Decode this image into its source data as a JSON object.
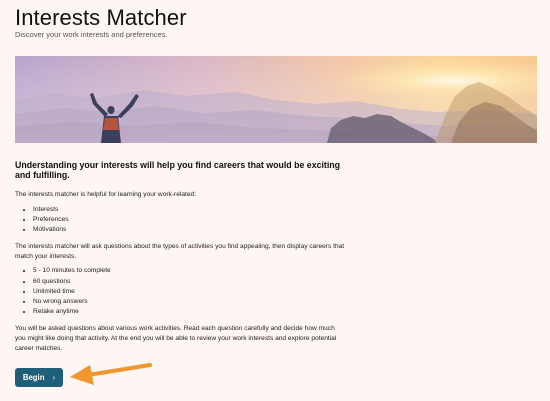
{
  "header": {
    "title": "Interests Matcher",
    "subtitle": "Discover your work interests and preferences."
  },
  "hero": {
    "image_alt": "Person with raised arms overlooking mountains at sunset"
  },
  "content": {
    "lead": "Understanding your interests will help you find careers that would be exciting and fulfilling.",
    "intro": "The interests matcher is helpful for learning your work-related:",
    "intro_items": [
      "Interests",
      "Preferences",
      "Motivations"
    ],
    "description": "The interests matcher will ask questions about the types of activities you find appealing, then display careers that match your interests.",
    "features": [
      "5 - 10 minutes to complete",
      "60 questions",
      "Unlimited time",
      "No wrong answers",
      "Retake anytime"
    ],
    "closing": "You will be asked questions about various work activities. Read each question carefully and decide how much you might like doing that activity. At the end you will be able to review your work interests and explore potential career matches."
  },
  "actions": {
    "begin_label": "Begin",
    "chevron": "›",
    "button_color": "#1f5f7a",
    "annotation_arrow_color": "#f0962e"
  }
}
